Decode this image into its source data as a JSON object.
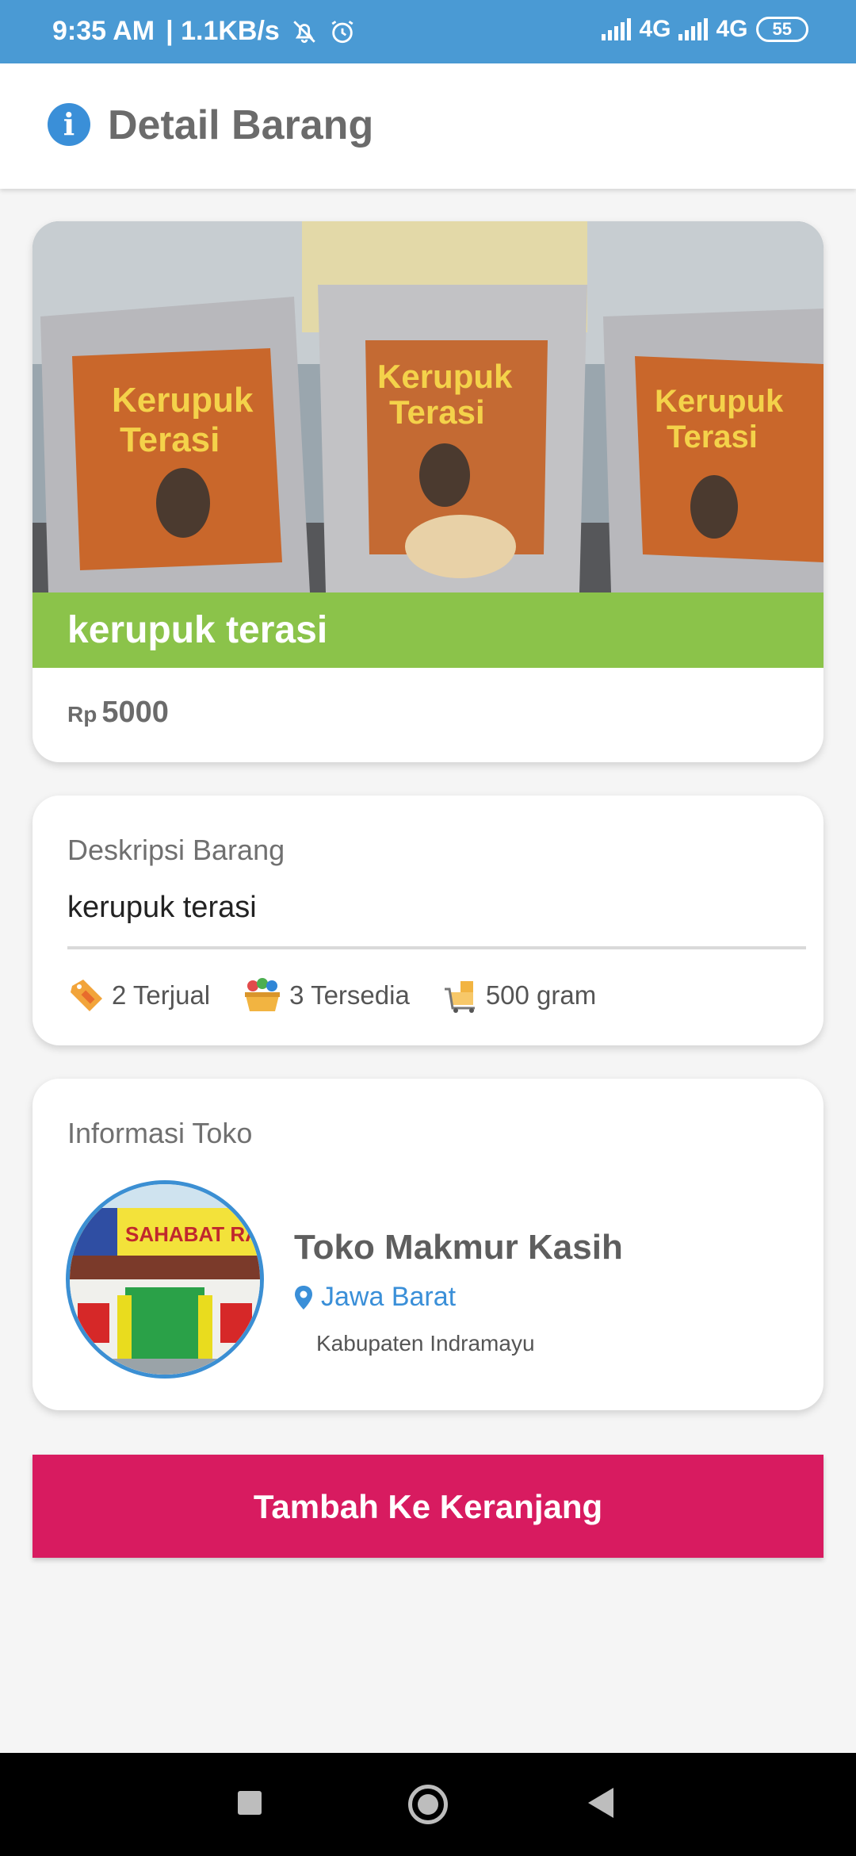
{
  "status_bar": {
    "time": "9:35 AM",
    "net_speed": "| 1.1KB/s",
    "net1": "4G",
    "net2": "4G",
    "battery": "55"
  },
  "app_bar": {
    "title": "Detail Barang",
    "icon": "info-icon"
  },
  "product": {
    "name": "kerupuk terasi",
    "currency": "Rp",
    "price": "5000",
    "image": "product-photo-kerupuk-terasi",
    "band_color": "#8bc34a"
  },
  "description": {
    "label": "Deskripsi Barang",
    "text": "kerupuk terasi",
    "stats": {
      "sold": "2 Terjual",
      "stock": "3 Tersedia",
      "weight": "500 gram"
    }
  },
  "shop": {
    "label": "Informasi Toko",
    "name": "Toko Makmur Kasih",
    "province": "Jawa Barat",
    "city": "Kabupaten Indramayu",
    "avatar": "shop-photo"
  },
  "actions": {
    "add_to_cart": "Tambah Ke Keranjang",
    "button_color": "#d81b60"
  },
  "nav": {
    "recent": "square-icon",
    "home": "home-circle-icon",
    "back": "back-triangle-icon"
  }
}
